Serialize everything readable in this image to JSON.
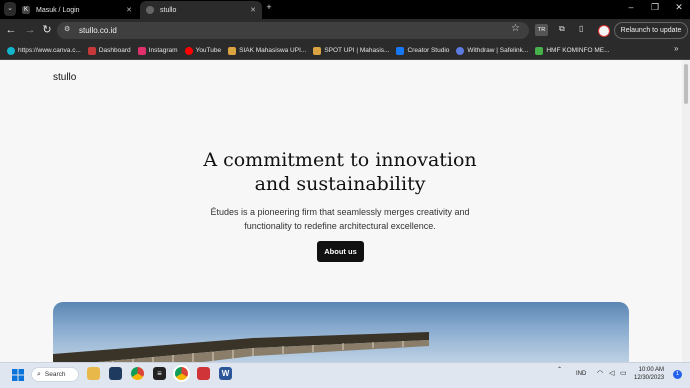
{
  "browser": {
    "tabs": [
      {
        "label": "Masuk / Login",
        "icon": "k-icon"
      },
      {
        "label": "stullo",
        "icon": "globe-icon"
      }
    ],
    "url": "stullo.co.id",
    "relaunch_label": "Relaunch to update",
    "profile_badge": "TR",
    "bookmarks": [
      {
        "label": "https://www.canva.c...",
        "color": "#12b5cb"
      },
      {
        "label": "Dashboard",
        "color": "#c7383a"
      },
      {
        "label": "Instagram",
        "color": "#e1306c"
      },
      {
        "label": "YouTube",
        "color": "#ff0000"
      },
      {
        "label": "SIAK Mahasiswa UPI...",
        "color": "#d9a441"
      },
      {
        "label": "SPOT UPI | Mahasis...",
        "color": "#d9a441"
      },
      {
        "label": "Creator Studio",
        "color": "#1877f2"
      },
      {
        "label": "Withdraw | Safelink...",
        "color": "#5b7be0"
      },
      {
        "label": "HMF KOMINFO ME...",
        "color": "#46b04a"
      }
    ]
  },
  "site": {
    "brand": "stullo",
    "headline_line1": "A commitment to innovation",
    "headline_line2": "and sustainability",
    "subtext_line1": "Études is a pioneering firm that seamlessly merges creativity and",
    "subtext_line2": "functionality to redefine architectural excellence.",
    "cta_label": "About us"
  },
  "taskbar": {
    "search_label": "Search",
    "language": "IND",
    "time": "10:00 AM",
    "date": "12/30/2023",
    "notification_count": "1"
  }
}
